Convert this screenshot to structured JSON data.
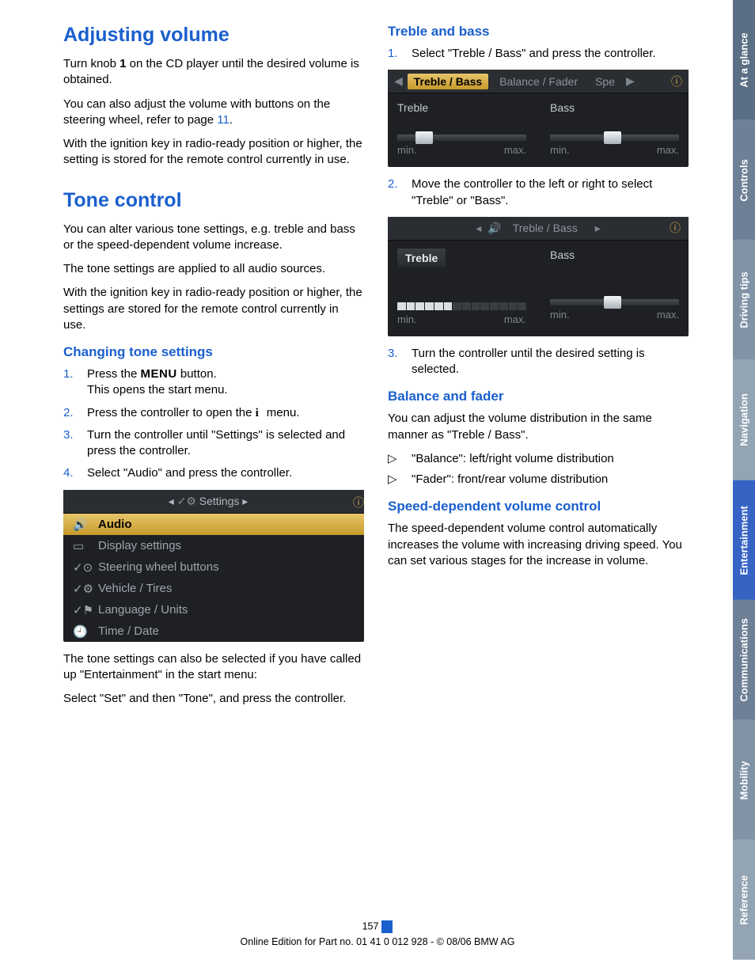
{
  "colLeft": {
    "h_adjust": "Adjusting volume",
    "p1a": "Turn knob ",
    "p1b": " on the CD player until the desired volume is obtained.",
    "knob": "1",
    "p2a": "You can also adjust the volume with buttons on the steering wheel, refer to page ",
    "p2b": ".",
    "pageref": "11",
    "p3": "With the ignition key in radio-ready position or higher, the setting is stored for the remote control currently in use.",
    "h_tone": "Tone control",
    "p4": "You can alter various tone settings, e.g. treble and bass or the speed-dependent volume increase.",
    "p5": "The tone settings are applied to all audio sources.",
    "p6": "With the ignition key in radio-ready position or higher, the settings are stored for the remote control currently in use.",
    "h_change": "Changing tone settings",
    "steps": [
      "Press the MENU button.\nThis opens the start menu.",
      "Press the controller to open the i menu.",
      "Turn the controller until \"Settings\" is selected and press the controller.",
      "Select \"Audio\" and press the controller."
    ],
    "menu_word": "MENU",
    "step1a": "Press the ",
    "step1b": " button.",
    "step1c": "This opens the start menu.",
    "step2a": "Press the controller to open the ",
    "step2b": " menu.",
    "step3": "Turn the controller until \"Settings\" is selected and press the controller.",
    "step4": "Select \"Audio\" and press the controller.",
    "settings_hdr": "Settings",
    "settings_items": [
      "Audio",
      "Display settings",
      "Steering wheel buttons",
      "Vehicle / Tires",
      "Language / Units",
      "Time / Date"
    ],
    "p7": "The tone settings can also be selected if you have called up \"Entertainment\" in the start menu:",
    "p8": "Select \"Set\" and then \"Tone\", and press the controller."
  },
  "colRight": {
    "h_treble": "Treble and bass",
    "r_step1": "Select \"Treble / Bass\" and press the controller.",
    "tabs1": [
      "Treble / Bass",
      "Balance / Fader",
      "Spe"
    ],
    "slider_labels": {
      "treble": "Treble",
      "bass": "Bass",
      "min": "min.",
      "max": "max."
    },
    "r_step2": "Move the controller to the left or right to select \"Treble\" or \"Bass\".",
    "tabs2_center": "Treble / Bass",
    "r_step3": "Turn the controller until the desired setting is selected.",
    "h_balance": "Balance and fader",
    "p_bal": "You can adjust the volume distribution in the same manner as \"Treble / Bass\".",
    "bul1": "\"Balance\": left/right volume distribution",
    "bul2": "\"Fader\": front/rear volume distribution",
    "h_speed": "Speed-dependent volume control",
    "p_speed": "The speed-dependent volume control automatically increases the volume with increasing driving speed. You can set various stages for the increase in volume."
  },
  "side": [
    "At a glance",
    "Controls",
    "Driving tips",
    "Navigation",
    "Entertainment",
    "Communications",
    "Mobility",
    "Reference"
  ],
  "footer": {
    "page": "157",
    "line": "Online Edition for Part no. 01 41 0 012 928 - © 08/06 BMW AG"
  },
  "nums": {
    "n1": "1.",
    "n2": "2.",
    "n3": "3.",
    "n4": "4."
  },
  "tri": "▷",
  "arrow_l": "◂",
  "arrow_r": "▸",
  "arrow_ll": "◀",
  "arrow_rr": "▶",
  "i_glyph": "i",
  "info_circle": "ⓘ"
}
